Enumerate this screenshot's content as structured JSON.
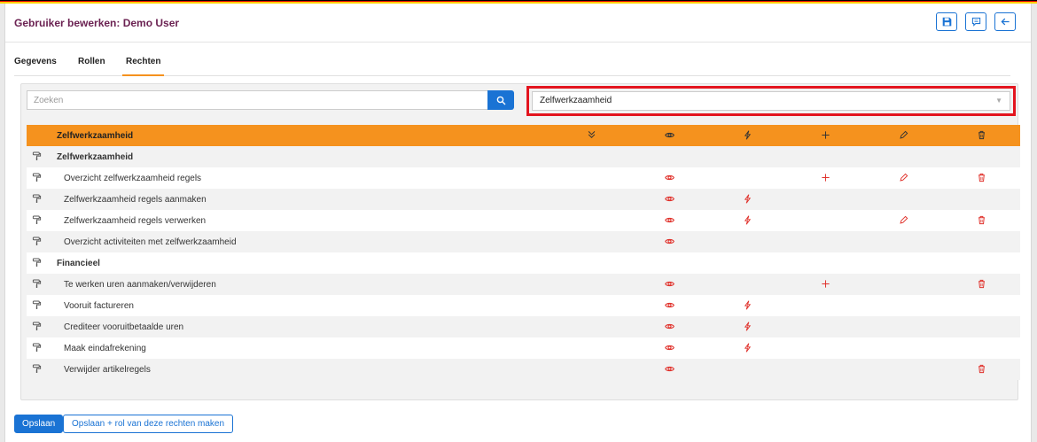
{
  "theme": {
    "accent": "#f5921e",
    "primary": "#1a73d4",
    "title_color": "#6b2252",
    "highlight": "#e3141e",
    "icon_red": "#e0312b",
    "flag": [
      "#000000",
      "#dd0000",
      "#ffce00"
    ]
  },
  "header": {
    "title": "Gebruiker bewerken: Demo User",
    "buttons": [
      {
        "name": "save",
        "icon": "floppy-icon"
      },
      {
        "name": "comment",
        "icon": "comment-icon"
      },
      {
        "name": "back",
        "icon": "arrow-left-icon"
      }
    ]
  },
  "tabs": [
    {
      "label": "Gegevens",
      "active": false
    },
    {
      "label": "Rollen",
      "active": false
    },
    {
      "label": "Rechten",
      "active": true
    }
  ],
  "search": {
    "placeholder": "Zoeken",
    "value": ""
  },
  "module_select": {
    "value": "Zelfwerkzaamheid"
  },
  "table": {
    "header_label": "Zelfwerkzaamheid",
    "header_icons": [
      "check-double-icon",
      "eye-icon",
      "bolt-icon",
      "plus-icon",
      "pencil-icon",
      "trash-icon"
    ],
    "rows": [
      {
        "label": "Zelfwerkzaamheid",
        "group": true,
        "perms": [
          false,
          false,
          false,
          false,
          false,
          false
        ]
      },
      {
        "label": "Overzicht zelfwerkzaamheid regels",
        "group": false,
        "perms": [
          false,
          true,
          false,
          true,
          true,
          true
        ]
      },
      {
        "label": "Zelfwerkzaamheid regels aanmaken",
        "group": false,
        "perms": [
          false,
          true,
          true,
          false,
          false,
          false
        ]
      },
      {
        "label": "Zelfwerkzaamheid regels verwerken",
        "group": false,
        "perms": [
          false,
          true,
          true,
          false,
          true,
          true
        ]
      },
      {
        "label": "Overzicht activiteiten met zelfwerkzaamheid",
        "group": false,
        "perms": [
          false,
          true,
          false,
          false,
          false,
          false
        ]
      },
      {
        "label": "Financieel",
        "group": true,
        "perms": [
          false,
          false,
          false,
          false,
          false,
          false
        ]
      },
      {
        "label": "Te werken uren aanmaken/verwijderen",
        "group": false,
        "perms": [
          false,
          true,
          false,
          true,
          false,
          true
        ]
      },
      {
        "label": "Vooruit factureren",
        "group": false,
        "perms": [
          false,
          true,
          true,
          false,
          false,
          false
        ]
      },
      {
        "label": "Crediteer vooruitbetaalde uren",
        "group": false,
        "perms": [
          false,
          true,
          true,
          false,
          false,
          false
        ]
      },
      {
        "label": "Maak eindafrekening",
        "group": false,
        "perms": [
          false,
          true,
          true,
          false,
          false,
          false
        ]
      },
      {
        "label": "Verwijder artikelregels",
        "group": false,
        "perms": [
          false,
          true,
          false,
          false,
          false,
          true
        ]
      }
    ]
  },
  "footer": {
    "save_label": "Opslaan",
    "save_role_label": "Opslaan + rol van deze rechten maken"
  }
}
